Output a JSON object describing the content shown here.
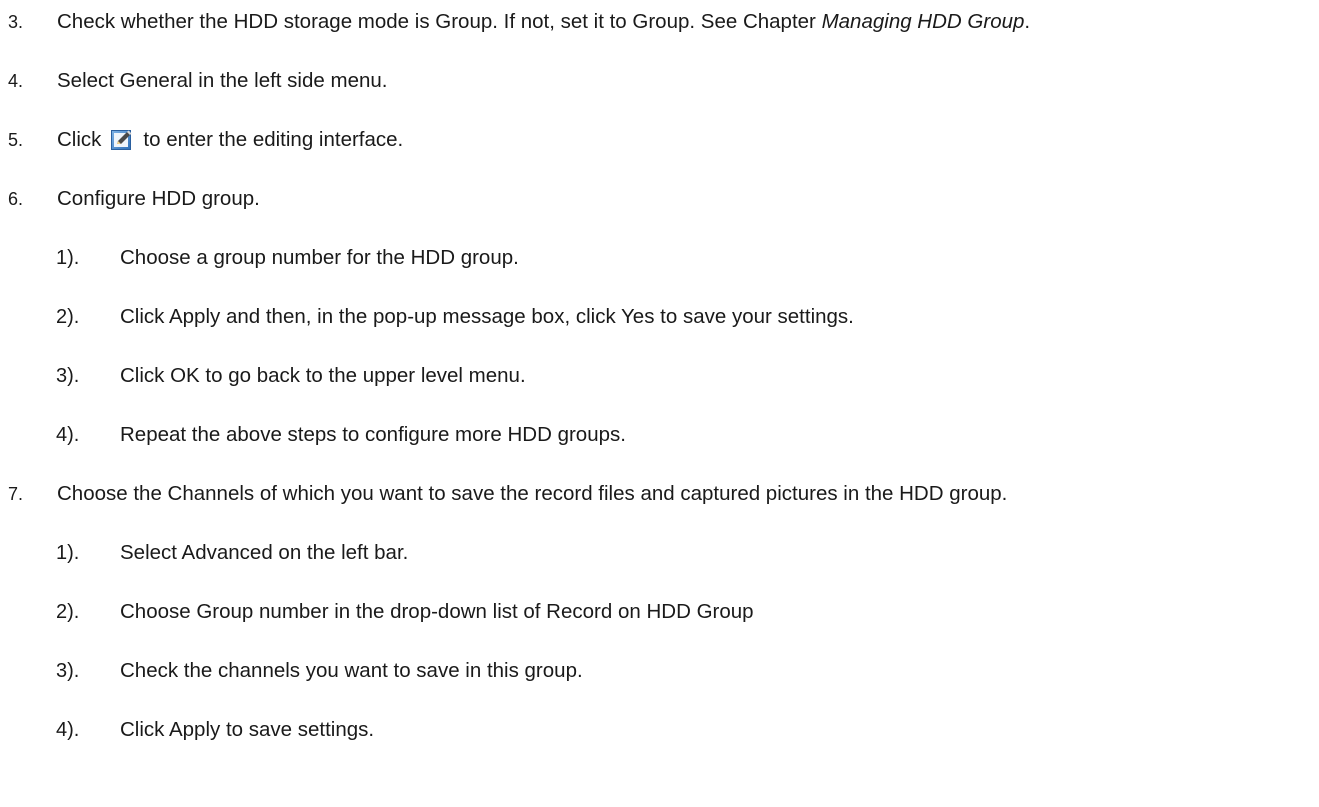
{
  "steps": [
    {
      "number": "3.",
      "text": "Check whether the HDD storage mode is Group. If not, set it to Group. See Chapter ",
      "ref": "Managing HDD Group",
      "suffix": "."
    },
    {
      "number": "4.",
      "text": "Select General in the left side menu."
    },
    {
      "number": "5.",
      "before_icon": "Click",
      "icon": "edit-icon",
      "after_icon": "to enter the editing interface."
    },
    {
      "number": "6.",
      "text": "Configure HDD group.",
      "substeps": [
        {
          "number": "1).",
          "text": "Choose a group number for the HDD group."
        },
        {
          "number": "2).",
          "text": "Click Apply and then, in the pop-up message box, click Yes to save your settings."
        },
        {
          "number": "3).",
          "text": "Click OK to go back to the upper level menu."
        },
        {
          "number": "4).",
          "text": "Repeat the above steps to configure more HDD groups."
        }
      ]
    },
    {
      "number": "7.",
      "text": "Choose the Channels of which you want to save the record files and captured pictures in the HDD group.",
      "substeps": [
        {
          "number": "1).",
          "text": "Select Advanced on the left bar."
        },
        {
          "number": "2).",
          "text": "Choose Group number in the drop-down list of Record on HDD Group"
        },
        {
          "number": "3).",
          "text": "Check the channels you want to save in this group."
        },
        {
          "number": "4).",
          "text": "Click Apply to save settings."
        }
      ]
    }
  ]
}
